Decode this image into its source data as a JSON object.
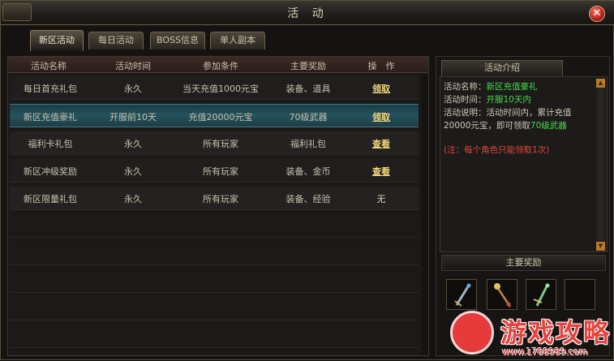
{
  "window": {
    "title": "活 动",
    "close_label": "✕"
  },
  "tabs": [
    {
      "label": "新区活动",
      "active": true
    },
    {
      "label": "每日活动",
      "active": false
    },
    {
      "label": "BOSS信息",
      "active": false
    },
    {
      "label": "单人副本",
      "active": false
    }
  ],
  "table": {
    "headers": [
      "活动名称",
      "活动时间",
      "参加条件",
      "主要奖励",
      "操　作"
    ],
    "rows": [
      {
        "name": "每日首充礼包",
        "time": "永久",
        "condition": "当天充值1000元宝",
        "reward": "装备、道具",
        "action": "领取"
      },
      {
        "name": "新区充值豪礼",
        "time": "开服前10天",
        "condition": "充值20000元宝",
        "reward": "70级武器",
        "action": "领取"
      },
      {
        "name": "福利卡礼包",
        "time": "永久",
        "condition": "所有玩家",
        "reward": "福利礼包",
        "action": "查看"
      },
      {
        "name": "新区冲级奖励",
        "time": "永久",
        "condition": "所有玩家",
        "reward": "装备、金币",
        "action": "查看"
      },
      {
        "name": "新区限量礼包",
        "time": "永久",
        "condition": "所有玩家",
        "reward": "装备、经验",
        "action": "无"
      }
    ],
    "selected_row": 1
  },
  "intro": {
    "header": "活动介绍",
    "name_label": "活动名称：",
    "name_value": "新区充值豪礼",
    "time_label": "活动时间：",
    "time_value": "开服10天内",
    "desc_label": "活动说明：活动时间内，累计充值20000元宝，即可领取",
    "desc_value": "70级武器",
    "note": "(注：每个角色只能领取1次)"
  },
  "rewards": {
    "header": "主要奖励",
    "items": [
      "sword-icon",
      "staff-icon",
      "blade-icon",
      "empty-slot"
    ]
  },
  "watermark": {
    "text": "游戏攻略",
    "url": "www.1788989.com"
  },
  "colors": {
    "highlight": "#49d94a",
    "note": "#e0483c",
    "action": "#f3d57b",
    "selected_row": "#24535c"
  }
}
